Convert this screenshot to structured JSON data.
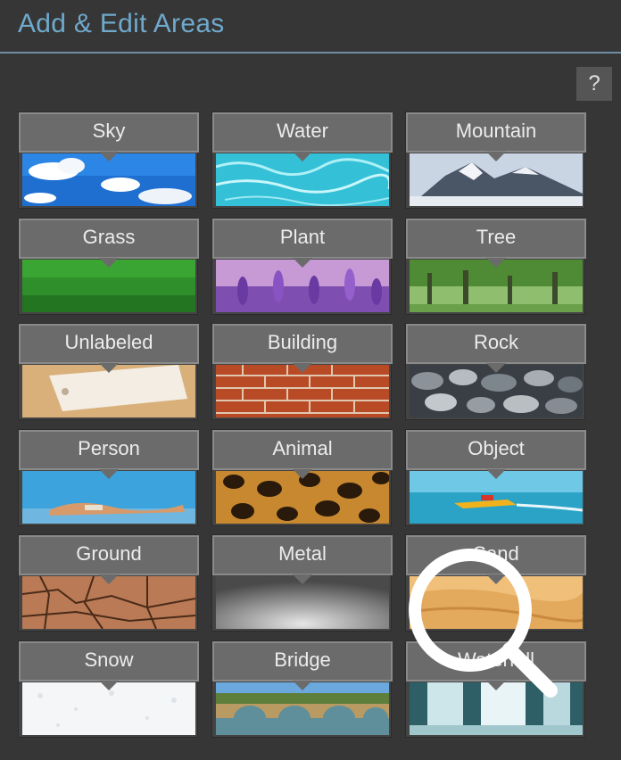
{
  "panel": {
    "title": "Add & Edit Areas",
    "help_label": "?"
  },
  "tiles": [
    {
      "label": "Sky"
    },
    {
      "label": "Water"
    },
    {
      "label": "Mountain"
    },
    {
      "label": "Grass"
    },
    {
      "label": "Plant"
    },
    {
      "label": "Tree"
    },
    {
      "label": "Unlabeled"
    },
    {
      "label": "Building"
    },
    {
      "label": "Rock"
    },
    {
      "label": "Person"
    },
    {
      "label": "Animal"
    },
    {
      "label": "Object"
    },
    {
      "label": "Ground"
    },
    {
      "label": "Metal"
    },
    {
      "label": "Sand"
    },
    {
      "label": "Snow"
    },
    {
      "label": "Bridge"
    },
    {
      "label": "Waterfall"
    }
  ],
  "colors": {
    "accent": "#6fa9cc",
    "panel_bg": "#363636",
    "tile_label_bg": "#6b6b6b"
  },
  "overlay_icon": "magnifier-icon"
}
